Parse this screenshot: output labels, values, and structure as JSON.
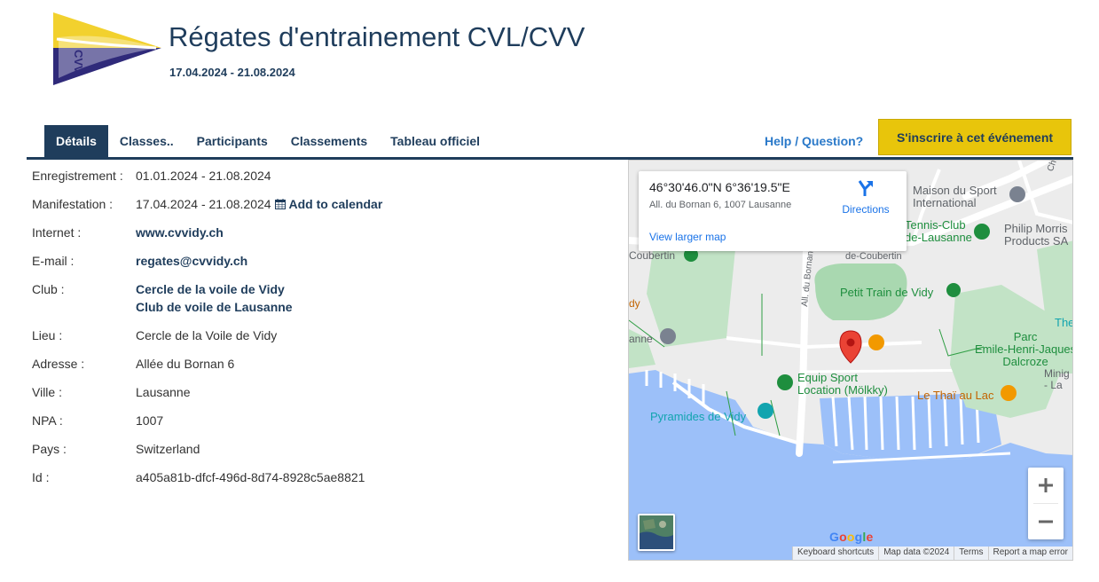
{
  "event": {
    "title": "Régates d'entrainement CVL/CVV",
    "dates": "17.04.2024 - 21.08.2024",
    "logo_text": "CVV"
  },
  "tabs": [
    {
      "label": "Détails",
      "active": true
    },
    {
      "label": "Classes..",
      "active": false
    },
    {
      "label": "Participants",
      "active": false
    },
    {
      "label": "Classements",
      "active": false
    },
    {
      "label": "Tableau officiel",
      "active": false
    }
  ],
  "help_label": "Help / Question?",
  "register_label": "S'inscrire à cet événement",
  "details": {
    "registration_label": "Enregistrement :",
    "registration_value": "01.01.2024 - 21.08.2024",
    "event_label": "Manifestation :",
    "event_value": "17.04.2024 - 21.08.2024",
    "add_calendar": "Add to calendar",
    "internet_label": "Internet :",
    "internet_value": "www.cvvidy.ch",
    "email_label": "E-mail :",
    "email_value": "regates@cvvidy.ch",
    "club_label": "Club :",
    "club_1": "Cercle de la voile de Vidy",
    "club_2": "Club de voile de Lausanne",
    "venue_label": "Lieu :",
    "venue_value": "Cercle de la Voile de Vidy",
    "address_label": "Adresse :",
    "address_value": "Allée du Bornan 6",
    "city_label": "Ville :",
    "city_value": "Lausanne",
    "zip_label": "NPA :",
    "zip_value": "1007",
    "country_label": "Pays :",
    "country_value": "Switzerland",
    "id_label": "Id :",
    "id_value": "a405a81b-dfcf-496d-8d74-8928c5ae8821"
  },
  "map": {
    "coords": "46°30'46.0\"N 6°36'19.5\"E",
    "address": "All. du Bornan 6, 1007 Lausanne",
    "directions": "Directions",
    "larger_map": "View larger map",
    "labels": {
      "maison_sport_1": "Maison du Sport",
      "maison_sport_2": "International",
      "tennis_1": "Tennis-Club",
      "tennis_2": "de-Lausanne",
      "philip_1": "Philip Morris",
      "philip_2": "Products SA",
      "chem": "Chem. d",
      "coubertin_left": "Coubertin",
      "coubertin_road": "de-Coubertin",
      "bornan_road": "All. du Bornan",
      "petit_train": "Petit Train de Vidy",
      "parc_1": "Parc",
      "parc_2": "Emile-Henri-Jaques",
      "parc_3": "Dalcroze",
      "the": "The",
      "minig_1": "Minig",
      "minig_2": "- La",
      "equip_1": "Equip Sport",
      "equip_2": "Location (Mölkky)",
      "thai": "Le Thaï au Lac",
      "pyramides": "Pyramides de Vidy",
      "lausanne_left": "anne",
      "dy_left": "dy"
    },
    "google": "Google",
    "attribution": [
      "Keyboard shortcuts",
      "Map data ©2024",
      "Terms",
      "Report a map error"
    ],
    "colors": {
      "water": "#9cc0f9",
      "park": "#c2e3c6",
      "park_dark": "#a9d8b0",
      "land": "#ececec",
      "road": "#ffffff",
      "pin": "#ea4335"
    }
  },
  "colors": {
    "brand_navy": "#1f3d5c",
    "register_yellow": "#e8c50b",
    "help_blue": "#2a79c9"
  }
}
